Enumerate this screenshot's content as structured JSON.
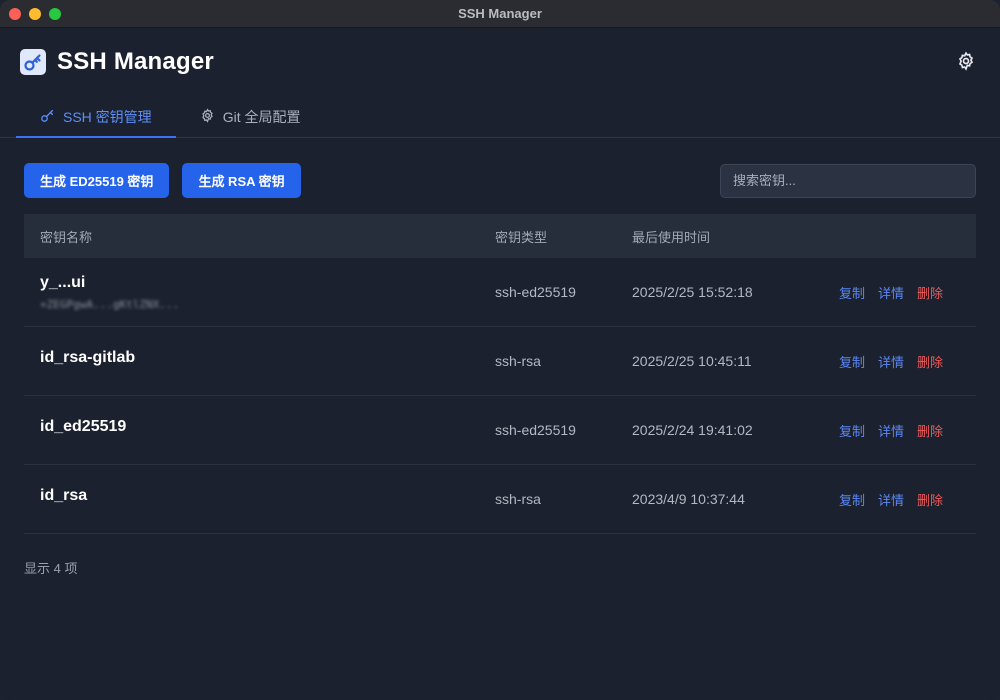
{
  "window": {
    "title": "SSH Manager"
  },
  "header": {
    "title": "SSH Manager",
    "settings_icon": "gear-icon",
    "logo_icon": "key-icon"
  },
  "tabs": [
    {
      "label": "SSH 密钥管理",
      "icon": "key-icon",
      "active": true
    },
    {
      "label": "Git 全局配置",
      "icon": "gear-icon",
      "active": false
    }
  ],
  "toolbar": {
    "gen_ed25519_label": "生成 ED25519 密钥",
    "gen_rsa_label": "生成 RSA 密钥",
    "search_placeholder": "搜索密钥..."
  },
  "table": {
    "columns": [
      "密钥名称",
      "密钥类型",
      "最后使用时间",
      ""
    ],
    "rows": [
      {
        "name": "y_...ui",
        "fingerprint": "+ZEGPgwA...gKtlZNX...",
        "type": "ssh-ed25519",
        "last_used": "2025/2/25 15:52:18"
      },
      {
        "name": "id_rsa-gitlab",
        "fingerprint": "",
        "type": "ssh-rsa",
        "last_used": "2025/2/25 10:45:11"
      },
      {
        "name": "id_ed25519",
        "fingerprint": "",
        "type": "ssh-ed25519",
        "last_used": "2025/2/24 19:41:02"
      },
      {
        "name": "id_rsa",
        "fingerprint": "",
        "type": "ssh-rsa",
        "last_used": "2023/4/9 10:37:44"
      }
    ],
    "actions": {
      "copy": "复制",
      "detail": "详情",
      "delete": "删除"
    }
  },
  "footer": {
    "count_text": "显示 4 项"
  },
  "colors": {
    "accent": "#2563eb",
    "danger": "#ef5b5b",
    "link": "#5b87f5",
    "background": "#1b212e"
  }
}
